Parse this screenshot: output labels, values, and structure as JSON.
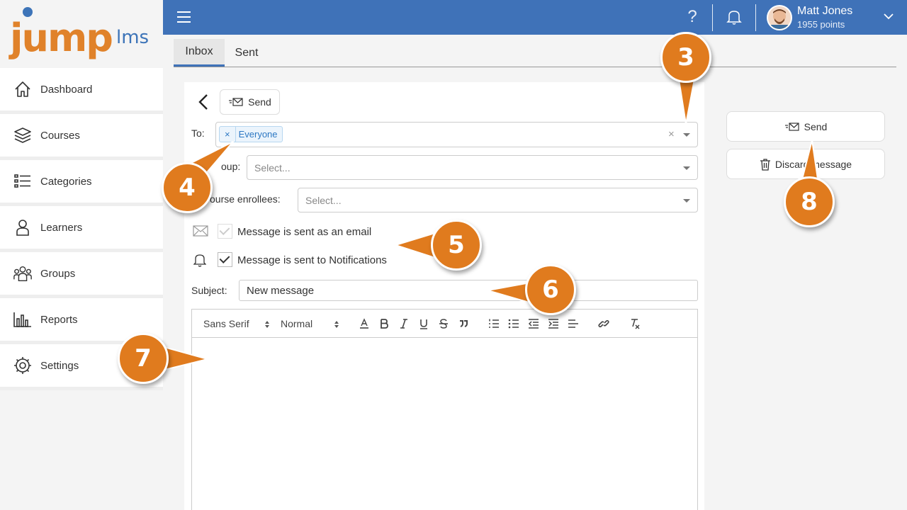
{
  "brand": {
    "logo_main": "jump",
    "logo_sub": "lms"
  },
  "sidebar": {
    "items": [
      {
        "label": "Dashboard",
        "icon": "home-icon"
      },
      {
        "label": "Courses",
        "icon": "courses-stack-icon"
      },
      {
        "label": "Categories",
        "icon": "categories-list-icon"
      },
      {
        "label": "Learners",
        "icon": "learner-person-icon"
      },
      {
        "label": "Groups",
        "icon": "groups-people-icon"
      },
      {
        "label": "Reports",
        "icon": "reports-bar-chart-icon"
      },
      {
        "label": "Settings",
        "icon": "settings-gear-icon"
      }
    ]
  },
  "topbar": {
    "help_icon": "?",
    "user": {
      "name": "Matt Jones",
      "points": "1955 points"
    }
  },
  "tabs": [
    {
      "label": "Inbox",
      "active": true
    },
    {
      "label": "Sent",
      "active": false
    }
  ],
  "compose": {
    "send_label": "Send",
    "to_label": "To:",
    "to_tag_remove": "×",
    "to_tag": "Everyone",
    "to_clear": "×",
    "group_label": "oup:",
    "group_placeholder": "Select...",
    "enrollees_label": "ourse enrollees:",
    "enrollees_placeholder": "Select...",
    "email_option": {
      "label": "Message is sent as an email",
      "checked": true,
      "disabled": true
    },
    "notify_option": {
      "label": "Message is sent to Notifications",
      "checked": true
    },
    "subject_label": "Subject:",
    "subject_value": "New message",
    "toolbar": {
      "font": "Sans Serif",
      "size": "Normal"
    }
  },
  "actions": {
    "send_label": "Send",
    "discard_label": "Discard message"
  },
  "callouts": [
    "3",
    "4",
    "5",
    "6",
    "7",
    "8"
  ],
  "colors": {
    "accent": "#3f72b8",
    "brand_orange": "#e0822a",
    "callout": "#e07b1e"
  }
}
